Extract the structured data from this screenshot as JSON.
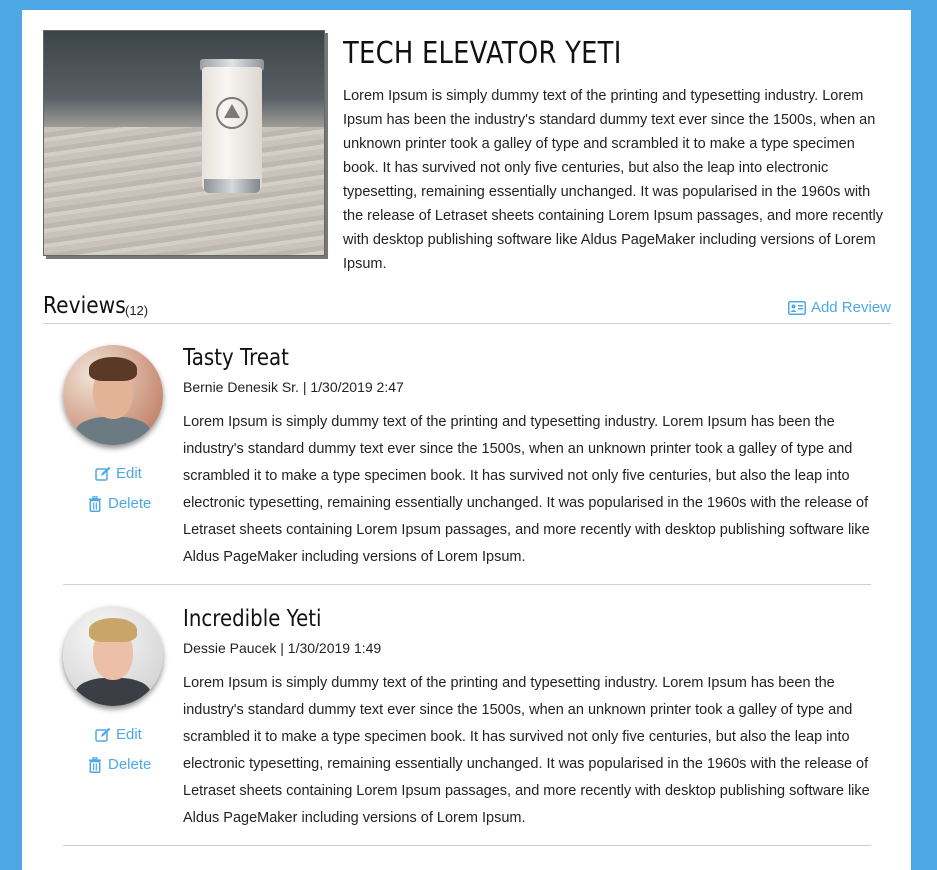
{
  "product": {
    "title": "TECH ELEVATOR YETI",
    "description": "Lorem Ipsum is simply dummy text of the printing and typesetting industry. Lorem Ipsum has been the industry's standard dummy text ever since the 1500s, when an unknown printer took a galley of type and scrambled it to make a type specimen book. It has survived not only five centuries, but also the leap into electronic typesetting, remaining essentially unchanged. It was popularised in the 1960s with the release of Letraset sheets containing Lorem Ipsum passages, and more recently with desktop publishing software like Aldus PageMaker including versions of Lorem Ipsum."
  },
  "reviews": {
    "heading": "Reviews",
    "count": "(12)",
    "add_label": "Add Review",
    "items": [
      {
        "title": "Tasty Treat",
        "meta": "Bernie Denesik Sr. | 1/30/2019 2:47",
        "body": "Lorem Ipsum is simply dummy text of the printing and typesetting industry. Lorem Ipsum has been the industry's standard dummy text ever since the 1500s, when an unknown printer took a galley of type and scrambled it to make a type specimen book. It has survived not only five centuries, but also the leap into electronic typesetting, remaining essentially unchanged. It was popularised in the 1960s with the release of Letraset sheets containing Lorem Ipsum passages, and more recently with desktop publishing software like Aldus PageMaker including versions of Lorem Ipsum.",
        "edit_label": "Edit",
        "delete_label": "Delete"
      },
      {
        "title": "Incredible Yeti",
        "meta": "Dessie Paucek | 1/30/2019 1:49",
        "body": "Lorem Ipsum is simply dummy text of the printing and typesetting industry. Lorem Ipsum has been the industry's standard dummy text ever since the 1500s, when an unknown printer took a galley of type and scrambled it to make a type specimen book. It has survived not only five centuries, but also the leap into electronic typesetting, remaining essentially unchanged. It was popularised in the 1960s with the release of Letraset sheets containing Lorem Ipsum passages, and more recently with desktop publishing software like Aldus PageMaker including versions of Lorem Ipsum.",
        "edit_label": "Edit",
        "delete_label": "Delete"
      }
    ]
  },
  "colors": {
    "page_background": "#4ea8e6",
    "accent": "#4ea8e6",
    "card": "#ffffff"
  },
  "icons": {
    "add_review": "address-card-icon",
    "edit": "edit-icon",
    "delete": "trash-icon"
  }
}
